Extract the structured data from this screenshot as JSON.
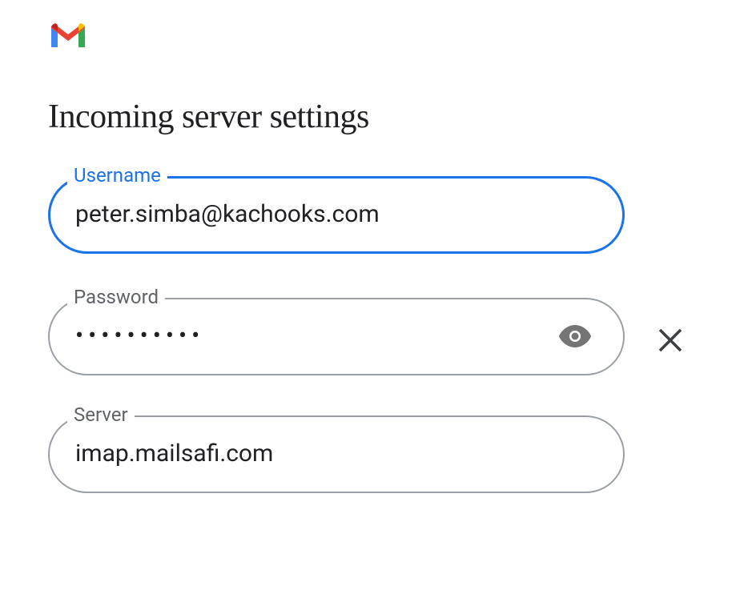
{
  "logo": {
    "name": "gmail"
  },
  "page": {
    "title": "Incoming server settings"
  },
  "fields": {
    "username": {
      "label": "Username",
      "value": "peter.simba@kachooks.com"
    },
    "password": {
      "label": "Password",
      "value_masked": "••••••••••"
    },
    "server": {
      "label": "Server",
      "value": "imap.mailsafi.com"
    }
  }
}
